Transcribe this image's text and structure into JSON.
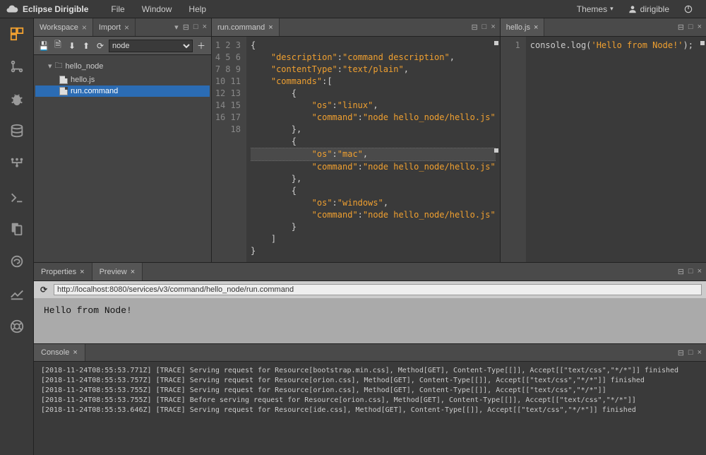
{
  "menubar": {
    "brand": "Eclipse Dirigible",
    "items": [
      "File",
      "Window",
      "Help"
    ],
    "themes": "Themes",
    "user": "dirigible"
  },
  "sidebar": {
    "tabs": {
      "workspace": "Workspace",
      "import": "Import"
    },
    "select_value": "node",
    "tree": {
      "root": "hello_node",
      "file1": "hello.js",
      "file2": "run.command"
    }
  },
  "editor_left": {
    "tab": "run.command",
    "lines": 18,
    "json": {
      "description_k": "\"description\"",
      "description_v": "\"command description\"",
      "contentType_k": "\"contentType\"",
      "contentType_v": "\"text/plain\"",
      "commands_k": "\"commands\"",
      "os_k": "\"os\"",
      "command_k": "\"command\"",
      "os_linux": "\"linux\"",
      "os_mac": "\"mac\"",
      "os_windows": "\"windows\"",
      "cmd_val": "\"node hello_node/hello.js\""
    }
  },
  "editor_right": {
    "tab": "hello.js",
    "lines": 1,
    "code_fn": "console.log",
    "code_str": "'Hello from Node!'"
  },
  "lower": {
    "properties_tab": "Properties",
    "preview_tab": "Preview",
    "url": "http://localhost:8080/services/v3/command/hello_node/run.command",
    "preview_text": "Hello from Node!",
    "console_tab": "Console",
    "console_lines": [
      "[2018-11-24T08:55:53.771Z] [TRACE] Serving request for Resource[bootstrap.min.css], Method[GET], Content-Type[[]], Accept[[\"text/css\",\"*/*\"]] finished",
      "[2018-11-24T08:55:53.757Z] [TRACE] Serving request for Resource[orion.css], Method[GET], Content-Type[[]], Accept[[\"text/css\",\"*/*\"]] finished",
      "[2018-11-24T08:55:53.755Z] [TRACE] Serving request for Resource[orion.css], Method[GET], Content-Type[[]], Accept[[\"text/css\",\"*/*\"]]",
      "[2018-11-24T08:55:53.755Z] [TRACE] Before serving request for Resource[orion.css], Method[GET], Content-Type[[]], Accept[[\"text/css\",\"*/*\"]]",
      "[2018-11-24T08:55:53.646Z] [TRACE] Serving request for Resource[ide.css], Method[GET], Content-Type[[]], Accept[[\"text/css\",\"*/*\"]] finished"
    ]
  }
}
